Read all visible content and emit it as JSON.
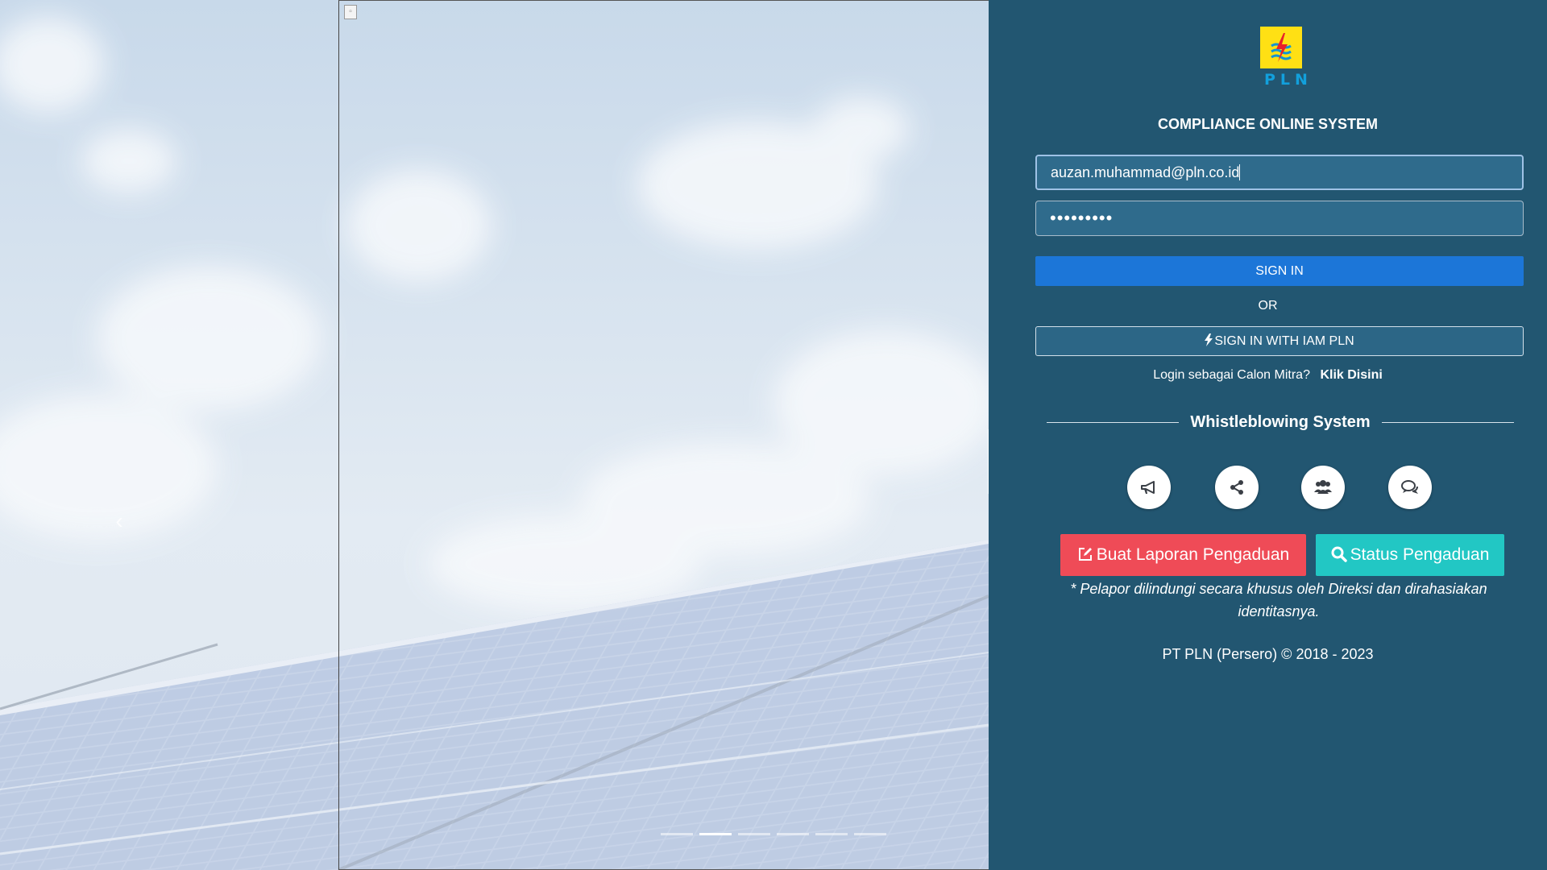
{
  "app": {
    "logo_text": "PLN",
    "title": "COMPLIANCE ONLINE SYSTEM"
  },
  "login": {
    "email_value": "auzan.muhammad@pln.co.id",
    "password_masked": "•••••••••",
    "sign_in_label": "SIGN IN",
    "or_label": "OR",
    "iam_label": "SIGN IN WITH IAM PLN",
    "mitra_prompt": "Login sebagai Calon Mitra?",
    "mitra_link": "Klik Disini"
  },
  "whistleblowing": {
    "heading": "Whistleblowing System",
    "icons": [
      "megaphone-icon",
      "share-icon",
      "users-icon",
      "comments-icon"
    ],
    "report_button": "Buat Laporan Pengaduan",
    "status_button": "Status Pengaduan",
    "note": "* Pelapor dilindungi secara khusus oleh Direksi dan dirahasiakan identitasnya."
  },
  "footer": {
    "copyright": "PT PLN (Persero) © 2018 - 2023"
  },
  "colors": {
    "panel": "#225671",
    "sign_in": "#1c76d8",
    "report": "#ef4b57",
    "status": "#22c7c4",
    "logo_bg": "#ffe014"
  },
  "carousel": {
    "slide_count": 6,
    "active_index": 1
  }
}
